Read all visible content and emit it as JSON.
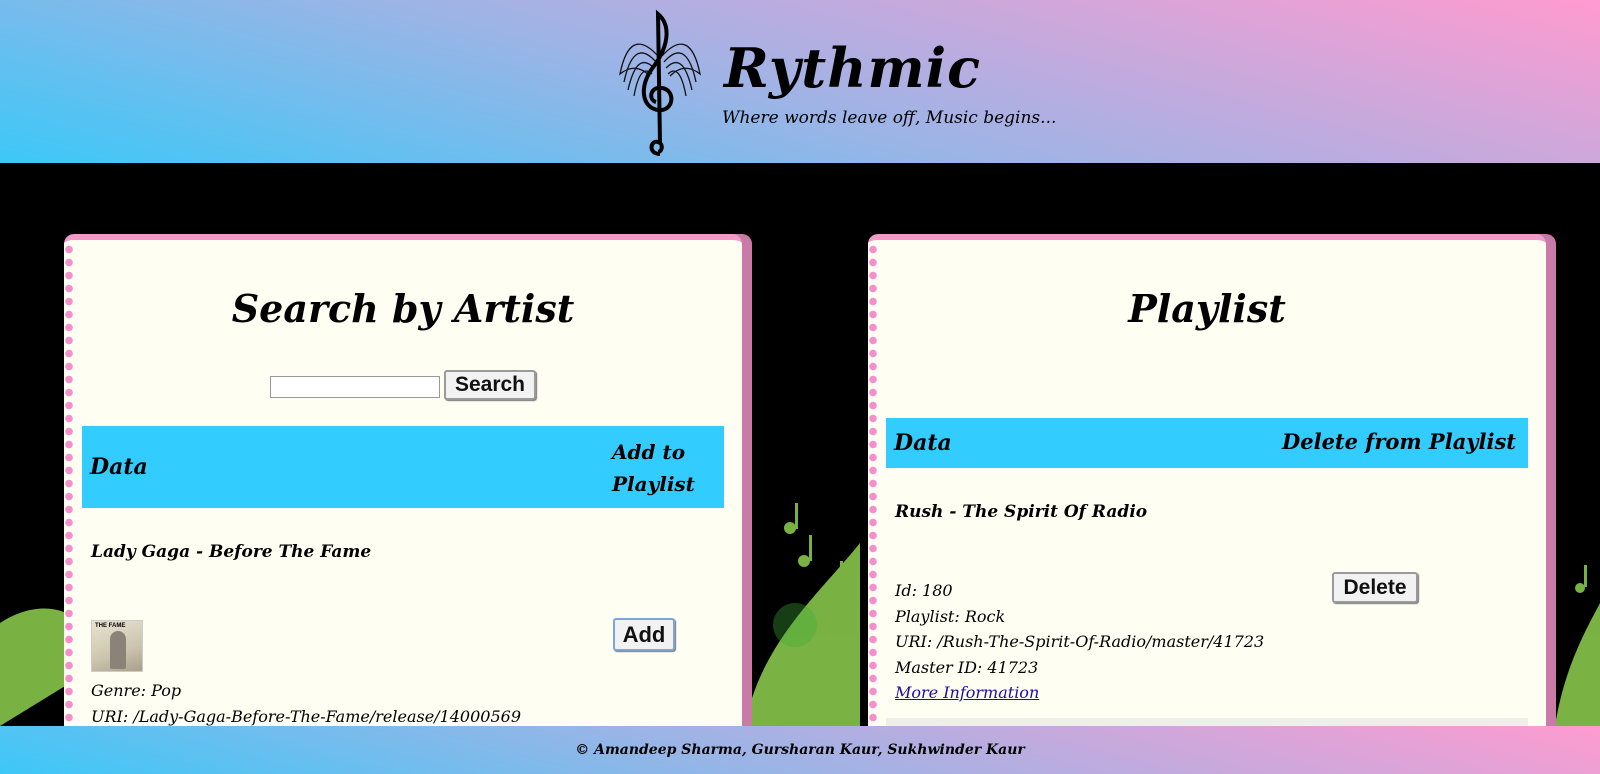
{
  "brand": {
    "title": "Rythmic",
    "tagline": "Where words leave off, Music begins...",
    "logo_icon": "treble-clef-wings-icon"
  },
  "search_panel": {
    "title": "Search by Artist",
    "search_input": {
      "value": "",
      "placeholder": ""
    },
    "search_button": "Search",
    "table_header": {
      "data": "Data",
      "action": "Add to Playlist"
    },
    "result": {
      "title": "Lady Gaga - Before The Fame",
      "thumbnail_text": "THE FAME",
      "add_button": "Add",
      "genre": "Genre: Pop",
      "uri": "URI: /Lady-Gaga-Before-The-Fame/release/14000569"
    }
  },
  "playlist_panel": {
    "title": "Playlist",
    "table_header": {
      "data": "Data",
      "action": "Delete from Playlist"
    },
    "item": {
      "title": "Rush - The Spirit Of Radio",
      "id": "Id: 180",
      "playlist": "Playlist: Rock",
      "uri": "URI: /Rush-The-Spirit-Of-Radio/master/41723",
      "master_id": "Master ID: 41723",
      "more_info": "More Information",
      "delete_button": "Delete"
    }
  },
  "footer": {
    "text": "© Amandeep Sharma, Gursharan Kaur, Sukhwinder Kaur"
  },
  "colors": {
    "header_gradient": [
      "#3cc8f7",
      "#ff9bd0"
    ],
    "panel_bg": "#fefef2",
    "panel_border": "#f49ac8",
    "table_header_bg": "#33ccff",
    "link": "#1a0dab"
  }
}
